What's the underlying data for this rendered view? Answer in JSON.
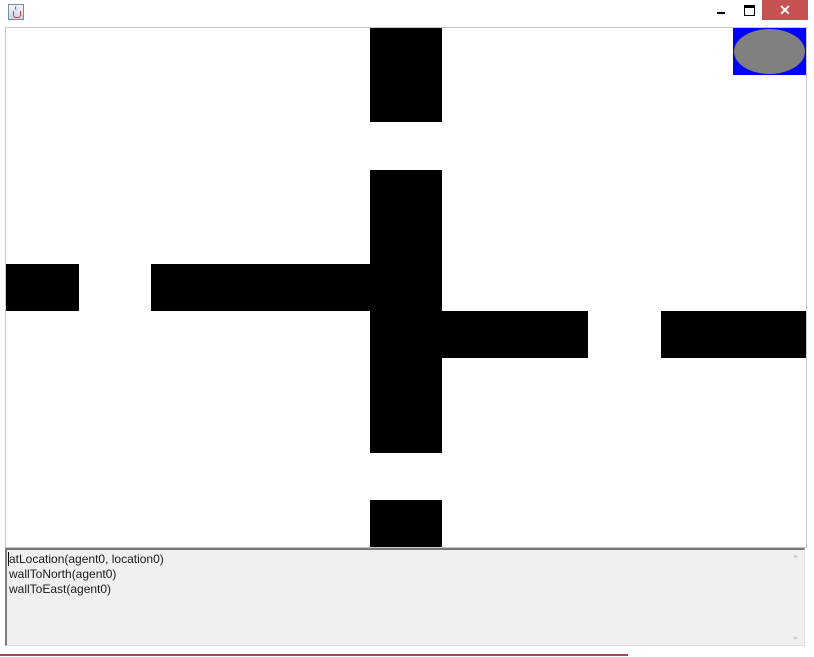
{
  "window": {
    "title": "",
    "controls": {
      "minimize": "_",
      "maximize": "",
      "close": "✕"
    }
  },
  "world": {
    "grid": {
      "columns": 11,
      "rows": 11
    },
    "walls": [
      {
        "col": 5,
        "row": 0
      },
      {
        "col": 5,
        "row": 1
      },
      {
        "col": 5,
        "row": 3
      },
      {
        "col": 5,
        "row": 4
      },
      {
        "col": 5,
        "row": 5
      },
      {
        "col": 5,
        "row": 6
      },
      {
        "col": 5,
        "row": 7
      },
      {
        "col": 5,
        "row": 8
      },
      {
        "col": 5,
        "row": 10
      },
      {
        "col": 0,
        "row": 5
      },
      {
        "col": 2,
        "row": 5
      },
      {
        "col": 3,
        "row": 5
      },
      {
        "col": 4,
        "row": 5
      },
      {
        "col": 6,
        "row": 6
      },
      {
        "col": 7,
        "row": 6
      },
      {
        "col": 9,
        "row": 6
      },
      {
        "col": 10,
        "row": 6
      }
    ],
    "agent": {
      "col": 10,
      "row": 0,
      "cell_color": "#0000ff",
      "body_color": "#808080"
    },
    "wall_color": "#000000"
  },
  "percepts": {
    "lines": [
      "atLocation(agent0, location0)",
      "wallToNorth(agent0)",
      "wallToEast(agent0)"
    ]
  },
  "icons": {
    "app": "java-coffee-cup-icon",
    "minimize": "minimize-icon",
    "maximize": "maximize-icon",
    "close": "close-icon",
    "scroll_up": "chevron-up-icon",
    "scroll_down": "chevron-down-icon"
  }
}
